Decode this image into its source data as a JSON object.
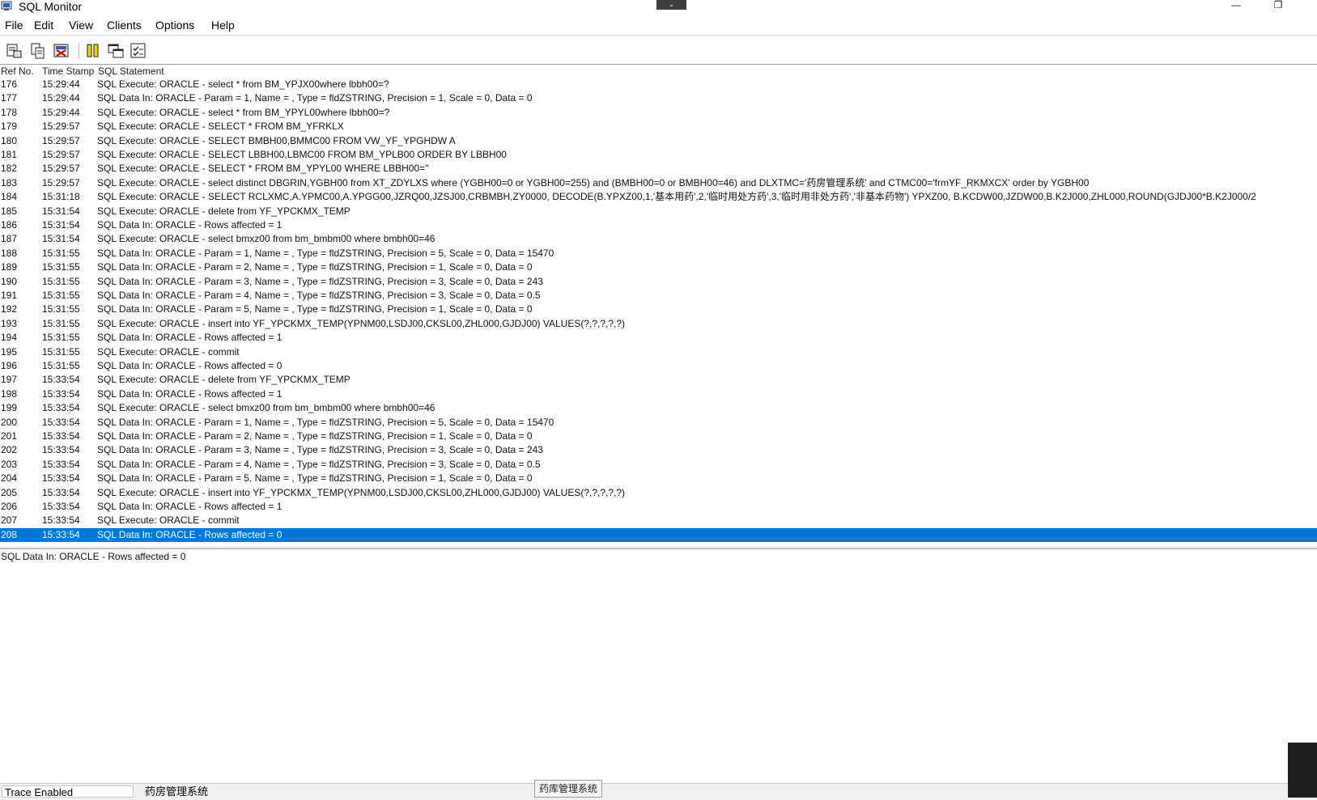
{
  "window": {
    "title": "SQL Monitor",
    "minimize_glyph": "—",
    "restore_glyph": "❐",
    "collapse_glyph": "⌄"
  },
  "menu": [
    "File",
    "Edit",
    "View",
    "Clients",
    "Options",
    "Help"
  ],
  "toolbar": {
    "buttons": [
      "save-log-icon",
      "copy-icon",
      "clear-icon",
      "pause-icon",
      "window-icon",
      "trace-options-icon"
    ]
  },
  "columns": {
    "ref": "Ref No.",
    "time": "Time Stamp",
    "sql": "SQL Statement"
  },
  "rows": [
    {
      "ref": "176",
      "time": "15:29:44",
      "sql": "SQL Execute: ORACLE - select * from BM_YPJX00where lbbh00=?"
    },
    {
      "ref": "177",
      "time": "15:29:44",
      "sql": "SQL Data In: ORACLE - Param = 1, Name = , Type = fldZSTRING, Precision = 1, Scale = 0, Data = 0"
    },
    {
      "ref": "178",
      "time": "15:29:44",
      "sql": "SQL Execute: ORACLE - select * from BM_YPYL00where lbbh00=?"
    },
    {
      "ref": "179",
      "time": "15:29:57",
      "sql": "SQL Execute: ORACLE - SELECT * FROM BM_YFRKLX"
    },
    {
      "ref": "180",
      "time": "15:29:57",
      "sql": "SQL Execute: ORACLE - SELECT  BMBH00,BMMC00  FROM VW_YF_YPGHDW A"
    },
    {
      "ref": "181",
      "time": "15:29:57",
      "sql": "SQL Execute: ORACLE - SELECT  LBBH00,LBMC00 FROM BM_YPLB00  ORDER BY LBBH00"
    },
    {
      "ref": "182",
      "time": "15:29:57",
      "sql": "SQL Execute: ORACLE - SELECT * FROM BM_YPYL00 WHERE LBBH00=''"
    },
    {
      "ref": "183",
      "time": "15:29:57",
      "sql": "SQL Execute: ORACLE - select distinct DBGRIN,YGBH00 from XT_ZDYLXS where (YGBH00=0 or YGBH00=255) and  (BMBH00=0 or  BMBH00=46) and DLXTMC='药房管理系统' and CTMC00='frmYF_RKMXCX' order by YGBH00"
    },
    {
      "ref": "184",
      "time": "15:31:18",
      "sql": "SQL Execute: ORACLE -  SELECT RCLXMC,A.YPMC00,A.YPGG00,JZRQ00,JZSJ00,CRBMBH,ZY0000, DECODE(B.YPXZ00,1,'基本用药',2,'临时用处方药',3,'临时用非处方药','非基本药物') YPXZ00, B.KCDW00,JZDW00,B.K2J000,ZHL000,ROUND(GJDJ00*B.K2J000/2"
    },
    {
      "ref": "185",
      "time": "15:31:54",
      "sql": "SQL Execute: ORACLE - delete from  YF_YPCKMX_TEMP"
    },
    {
      "ref": "186",
      "time": "15:31:54",
      "sql": "SQL Data In: ORACLE - Rows affected = 1"
    },
    {
      "ref": "187",
      "time": "15:31:54",
      "sql": "SQL Execute: ORACLE - select bmxz00 from bm_bmbm00 where bmbh00=46"
    },
    {
      "ref": "188",
      "time": "15:31:55",
      "sql": "SQL Data In: ORACLE - Param = 1, Name = , Type = fldZSTRING, Precision = 5, Scale = 0, Data = 15470"
    },
    {
      "ref": "189",
      "time": "15:31:55",
      "sql": "SQL Data In: ORACLE - Param = 2, Name = , Type = fldZSTRING, Precision = 1, Scale = 0, Data = 0"
    },
    {
      "ref": "190",
      "time": "15:31:55",
      "sql": "SQL Data In: ORACLE - Param = 3, Name = , Type = fldZSTRING, Precision = 3, Scale = 0, Data = 243"
    },
    {
      "ref": "191",
      "time": "15:31:55",
      "sql": "SQL Data In: ORACLE - Param = 4, Name = , Type = fldZSTRING, Precision = 3, Scale = 0, Data = 0.5"
    },
    {
      "ref": "192",
      "time": "15:31:55",
      "sql": "SQL Data In: ORACLE - Param = 5, Name = , Type = fldZSTRING, Precision = 1, Scale = 0, Data = 0"
    },
    {
      "ref": "193",
      "time": "15:31:55",
      "sql": "SQL Execute: ORACLE - insert into YF_YPCKMX_TEMP(YPNM00,LSDJ00,CKSL00,ZHL000,GJDJ00) VALUES(?,?,?,?,?)"
    },
    {
      "ref": "194",
      "time": "15:31:55",
      "sql": "SQL Data In: ORACLE - Rows affected = 1"
    },
    {
      "ref": "195",
      "time": "15:31:55",
      "sql": "SQL Execute: ORACLE - commit"
    },
    {
      "ref": "196",
      "time": "15:31:55",
      "sql": "SQL Data In: ORACLE - Rows affected = 0"
    },
    {
      "ref": "197",
      "time": "15:33:54",
      "sql": "SQL Execute: ORACLE - delete from  YF_YPCKMX_TEMP"
    },
    {
      "ref": "198",
      "time": "15:33:54",
      "sql": "SQL Data In: ORACLE - Rows affected = 1"
    },
    {
      "ref": "199",
      "time": "15:33:54",
      "sql": "SQL Execute: ORACLE - select bmxz00 from bm_bmbm00 where bmbh00=46"
    },
    {
      "ref": "200",
      "time": "15:33:54",
      "sql": "SQL Data In: ORACLE - Param = 1, Name = , Type = fldZSTRING, Precision = 5, Scale = 0, Data = 15470"
    },
    {
      "ref": "201",
      "time": "15:33:54",
      "sql": "SQL Data In: ORACLE - Param = 2, Name = , Type = fldZSTRING, Precision = 1, Scale = 0, Data = 0"
    },
    {
      "ref": "202",
      "time": "15:33:54",
      "sql": "SQL Data In: ORACLE - Param = 3, Name = , Type = fldZSTRING, Precision = 3, Scale = 0, Data = 243"
    },
    {
      "ref": "203",
      "time": "15:33:54",
      "sql": "SQL Data In: ORACLE - Param = 4, Name = , Type = fldZSTRING, Precision = 3, Scale = 0, Data = 0.5"
    },
    {
      "ref": "204",
      "time": "15:33:54",
      "sql": "SQL Data In: ORACLE - Param = 5, Name = , Type = fldZSTRING, Precision = 1, Scale = 0, Data = 0"
    },
    {
      "ref": "205",
      "time": "15:33:54",
      "sql": "SQL Execute: ORACLE - insert into YF_YPCKMX_TEMP(YPNM00,LSDJ00,CKSL00,ZHL000,GJDJ00) VALUES(?,?,?,?,?)"
    },
    {
      "ref": "206",
      "time": "15:33:54",
      "sql": "SQL Data In: ORACLE - Rows affected = 1"
    },
    {
      "ref": "207",
      "time": "15:33:54",
      "sql": "SQL Execute: ORACLE - commit"
    },
    {
      "ref": "208",
      "time": "15:33:54",
      "sql": "SQL Data In: ORACLE - Rows affected = 0",
      "selected": true
    }
  ],
  "detail": {
    "text": "SQL Data In: ORACLE - Rows affected = 0"
  },
  "status": {
    "trace": "Trace Enabled",
    "client": "药房管理系统"
  },
  "tooltip": {
    "text": "药库管理系统"
  },
  "colors": {
    "selection": "#0078d7",
    "background": "#ffffff"
  }
}
